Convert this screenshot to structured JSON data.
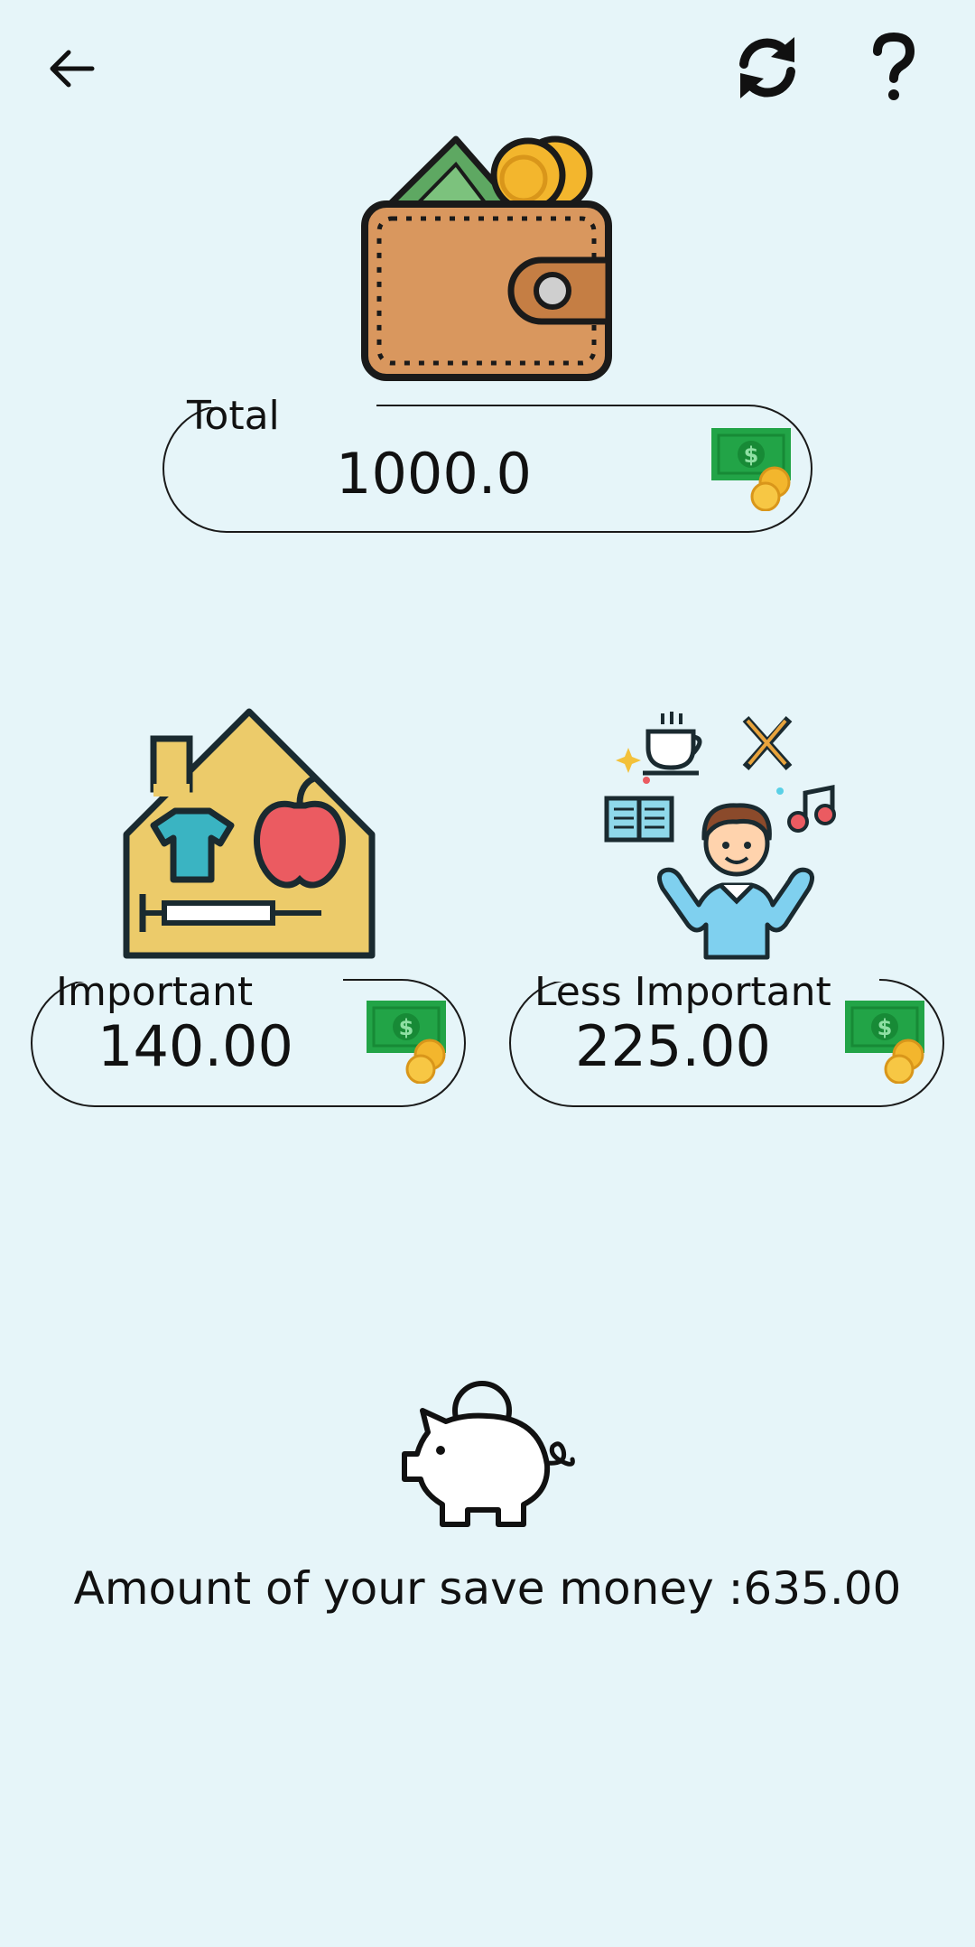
{
  "colors": {
    "background": "#e6f5f9",
    "wallet": "#d9975e",
    "house": "#eccb6a",
    "money_green": "#22a447",
    "coin_gold": "#f3b62d"
  },
  "header": {
    "back_icon": "arrow-left-icon",
    "refresh_icon": "refresh-icon",
    "help_icon": "question-mark-icon"
  },
  "total": {
    "label": "Total",
    "value": "1000.0",
    "illustration": "wallet-icon"
  },
  "important": {
    "label": "Important",
    "value": "140.00",
    "illustration": "house-essentials-icon"
  },
  "less_important": {
    "label": "Less Important",
    "value": "225.00",
    "illustration": "hobbies-person-icon"
  },
  "savings": {
    "text": "Amount of your save money :635.00",
    "illustration": "piggy-bank-icon"
  }
}
